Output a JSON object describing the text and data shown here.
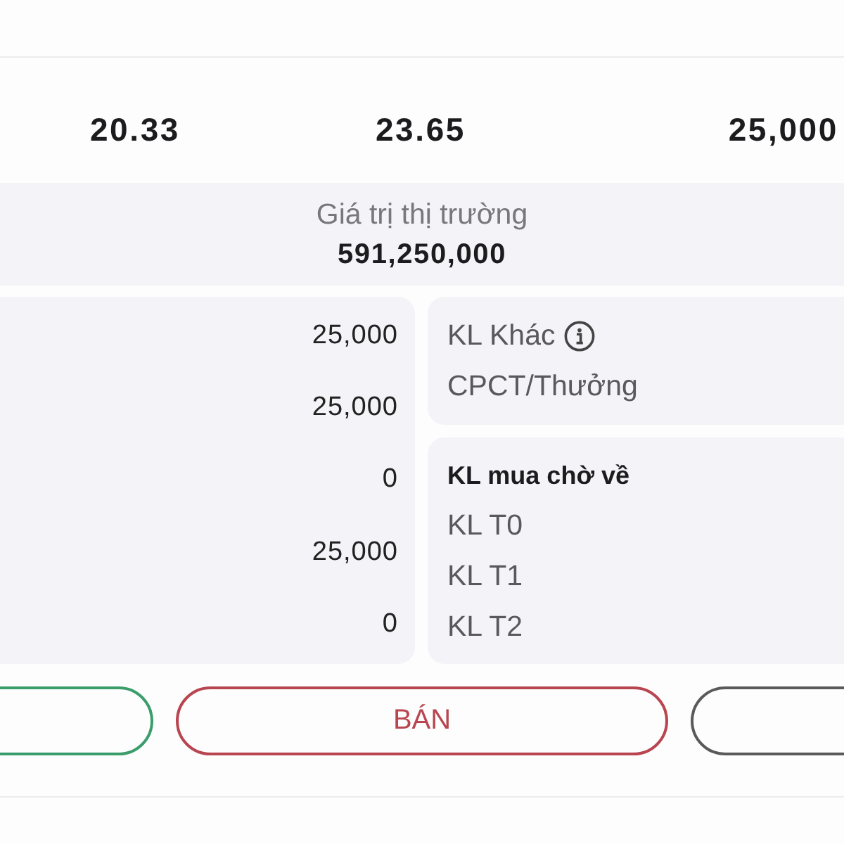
{
  "stats": [
    {
      "value": "20.33"
    },
    {
      "value": "23.65"
    },
    {
      "value": "25,000"
    }
  ],
  "market_value": {
    "label": "Giá trị thị trường",
    "value": "591,250,000"
  },
  "quantities": [
    "25,000",
    "25,000",
    "0",
    "25,000",
    "0"
  ],
  "other_card": {
    "rows": [
      {
        "label": "KL Khác",
        "info": true
      },
      {
        "label": "CPCT/Thưởng",
        "info": false
      }
    ]
  },
  "pending_card": {
    "title": "KL mua chờ về",
    "rows": [
      "KL T0",
      "KL T1",
      "KL T2"
    ]
  },
  "buttons": [
    {
      "color": "#3a9d6b"
    },
    {
      "label": "BÁN",
      "color": "#b8454f"
    },
    {
      "color": "#5a5a5a"
    }
  ]
}
